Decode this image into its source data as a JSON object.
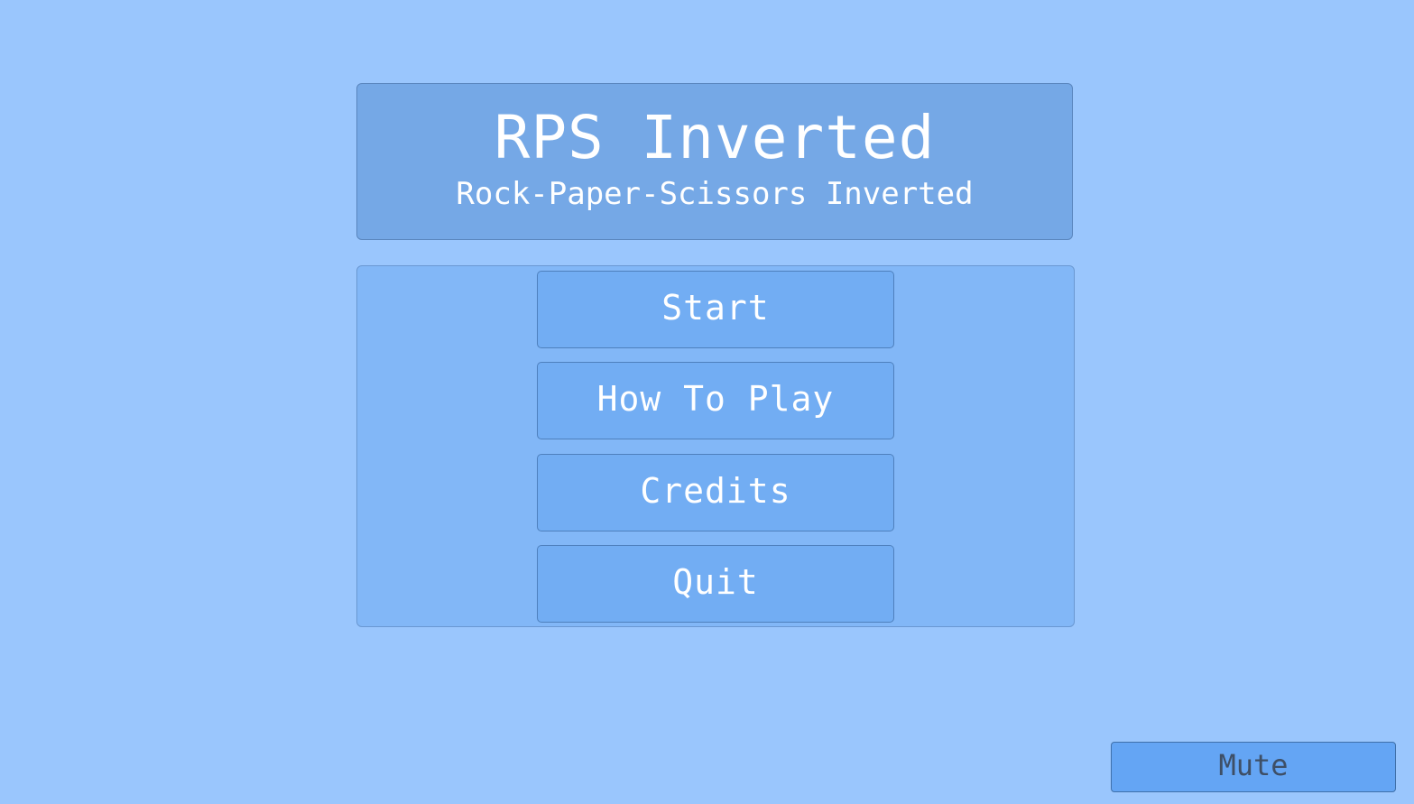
{
  "title_panel": {
    "title": "RPS Inverted",
    "subtitle": "Rock-Paper-Scissors Inverted"
  },
  "menu": {
    "start_label": "Start",
    "how_to_play_label": "How To Play",
    "credits_label": "Credits",
    "quit_label": "Quit"
  },
  "mute_label": "Mute",
  "colors": {
    "background": "#9ac6fd",
    "title_panel": "#75a8e6",
    "menu_panel": "#82b7f7",
    "button": "#72adf3",
    "mute_button": "#64a5f4",
    "text": "#ffffff"
  }
}
